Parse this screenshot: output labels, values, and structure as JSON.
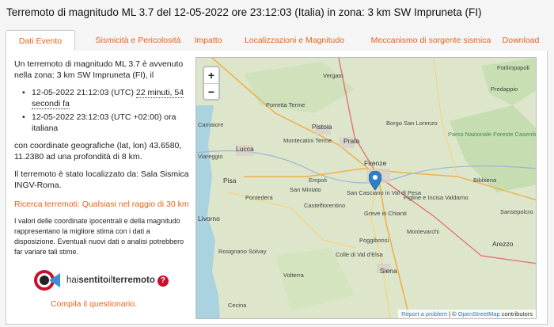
{
  "page_title": "Terremoto di magnitudo ML 3.7 del 12-05-2022 ore 23:12:03 (Italia) in zona: 3 km SW Impruneta (FI)",
  "tabs": [
    {
      "label": "Dati Evento",
      "active": true
    },
    {
      "label": "Sismicità e Pericolosità"
    },
    {
      "label": "Impatto"
    },
    {
      "label": "Localizzazioni e Magnitudo"
    },
    {
      "label": "Meccanismo di sorgente sismica"
    },
    {
      "label": "Download"
    }
  ],
  "event": {
    "intro": "Un terremoto di magnitudo ML 3.7 è avvenuto nella zona: 3 km SW Impruneta (FI), il",
    "utc_time": "12-05-2022 21:12:03 (UTC)",
    "ago": "22 minuti, 54 secondi fa",
    "local_time": "12-05-2022 23:12:03 (UTC +02:00) ora italiana",
    "coords": "con coordinate geografiche (lat, lon) 43.6580, 11.2380 ad una profondità di 8 km.",
    "located_by": "Il terremoto è stato localizzato da: Sala Sismica INGV-Roma.",
    "search_label": "Ricerca terremoti:",
    "search_link": "Qualsiasi nel raggio di 30 km",
    "disclaimer": "I valori delle coordinate ipocentrali e della magnitudo rappresentano la migliore stima con i dati a disposizione. Eventuali nuovi dati o analisi potrebbero far variare tali stime."
  },
  "hst": {
    "text_a": "hai",
    "text_b": "sentito",
    "text_c": "il",
    "text_d": "terremoto",
    "q": "?",
    "link": "Compila il questionario."
  },
  "map": {
    "zoom_in": "+",
    "zoom_out": "−",
    "attr_report": "Report a problem",
    "attr_sep": " | © ",
    "attr_osm": "OpenStreetMap",
    "attr_contrib": " contributors",
    "places": [
      {
        "name": "Forlimpopoli"
      },
      {
        "name": "Vergato"
      },
      {
        "name": "Predappio"
      },
      {
        "name": "Porretta Terme"
      },
      {
        "name": "Prato"
      },
      {
        "name": "Borgo San Lorenzo"
      },
      {
        "name": "Pistoia"
      },
      {
        "name": "Firenze"
      },
      {
        "name": "Lucca"
      },
      {
        "name": "Pisa"
      },
      {
        "name": "Empoli"
      },
      {
        "name": "San Casciano in Val di Pesa"
      },
      {
        "name": "Livorno"
      },
      {
        "name": "Poggibonsi"
      },
      {
        "name": "Colle di Val d'Elsa"
      },
      {
        "name": "Siena"
      },
      {
        "name": "Arezzo"
      },
      {
        "name": "Bibbiena"
      },
      {
        "name": "Montevarchi"
      },
      {
        "name": "Figline e Incisa Valdarno"
      },
      {
        "name": "Camaiore"
      },
      {
        "name": "Viareggio"
      },
      {
        "name": "Rosignano Solvay"
      },
      {
        "name": "Cecina"
      },
      {
        "name": "Volterra"
      },
      {
        "name": "Sansepolcro"
      },
      {
        "name": "Castelfiorentino"
      },
      {
        "name": "Greve in Chianti"
      },
      {
        "name": "Montecatini Terme"
      },
      {
        "name": "Pontedera"
      },
      {
        "name": "San Miniato"
      },
      {
        "name": "Parco Nazionale Foreste Casentinesi"
      }
    ]
  },
  "colors": {
    "accent": "#e8631a",
    "marker": "#2b82cb",
    "brand_red": "#c8102e"
  }
}
